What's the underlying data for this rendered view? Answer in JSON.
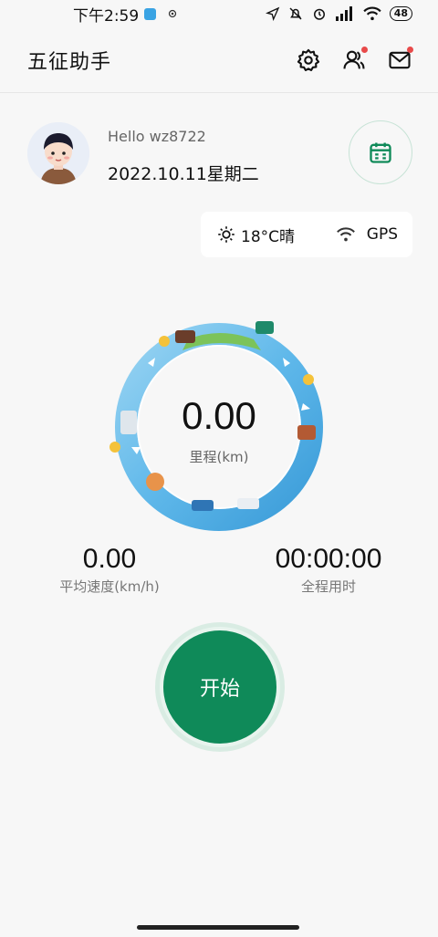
{
  "status_bar": {
    "time": "下午2:59",
    "battery": "48"
  },
  "header": {
    "title": "五征助手"
  },
  "user": {
    "greeting": "Hello wz8722",
    "date": "2022.10.11星期二"
  },
  "weather": {
    "temperature": "18°C晴",
    "gps_label": "GPS"
  },
  "odometer": {
    "value": "0.00",
    "label": "里程(km)"
  },
  "stats": {
    "avg_speed_value": "0.00",
    "avg_speed_label": "平均速度(km/h)",
    "total_time_value": "00:00:00",
    "total_time_label": "全程用时"
  },
  "start_button": {
    "label": "开始"
  },
  "colors": {
    "accent": "#0f8a59",
    "ring_blue": "#5fb8ea",
    "notification_dot": "#e84a4a"
  }
}
